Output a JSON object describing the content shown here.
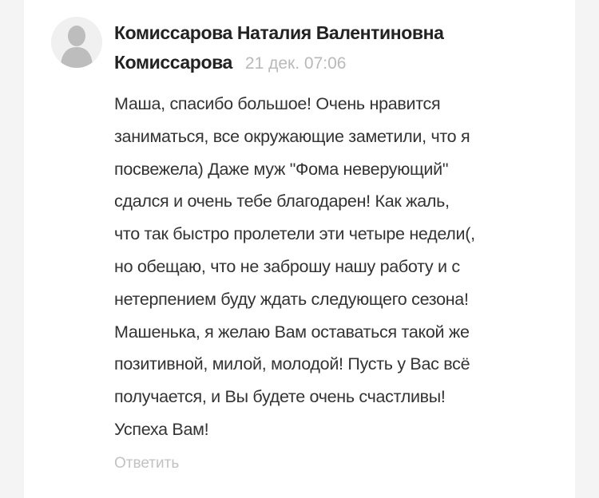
{
  "comment": {
    "author_line1": "Комиссарова Наталия Валентиновна",
    "author_line2": "Комиссарова",
    "date": "21 дек. 07:06",
    "text_lines": [
      "Маша, спасибо большое! Очень нравится",
      "заниматься, все окружающие заметили, что я",
      "посвежела) Даже муж \"Фома неверующий\"",
      "сдался и очень тебе благодарен! Как жаль,",
      "что так быстро пролетели эти четыре недели(,",
      "но обещаю, что не заброшу нашу работу и с",
      "нетерпением буду ждать следующего сезона!",
      "Машенька, я желаю Вам оставаться такой же",
      "позитивной, милой, молодой! Пусть у Вас всё",
      "получается, и Вы будете очень счастливы!",
      "Успеха Вам!"
    ],
    "reply_label": "Ответить",
    "avatar_icon": "user-silhouette-icon"
  }
}
